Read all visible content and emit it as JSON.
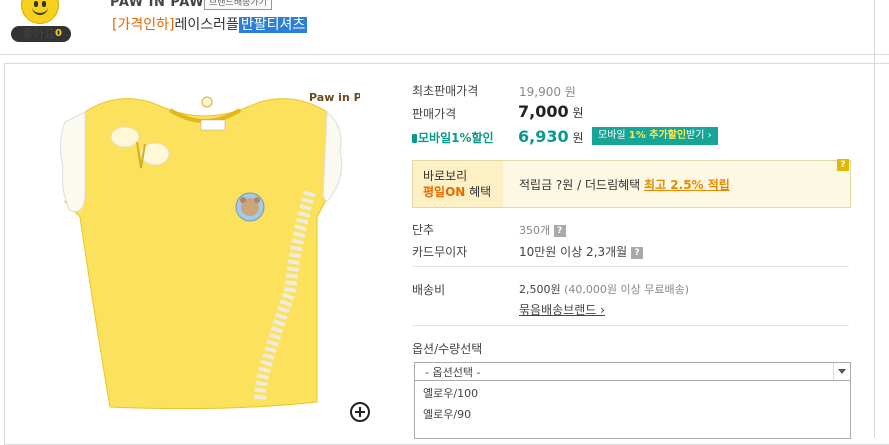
{
  "header": {
    "like_label": "좋아요",
    "like_count": "0",
    "brand_name": "PAW IN PAW",
    "brand_button": "브랜드배송가기",
    "title_prefix": "[가격인하]",
    "title_main": "레이스러플",
    "title_highlight": "반팔티셔츠"
  },
  "product_image": {
    "logo_text": "Paw in Paw",
    "zoom_icon": "zoom-in-icon"
  },
  "price": {
    "original_label": "최초판매가격",
    "original_value": "19,900 원",
    "sale_label": "판매가격",
    "sale_value": "7,000",
    "sale_unit": "원",
    "mobile_label": "모바일1%할인",
    "mobile_value": "6,930",
    "mobile_unit": "원",
    "mobile_button_prefix": "모바일 ",
    "mobile_button_strong": "1% 추가할인",
    "mobile_button_suffix": "받기 ›"
  },
  "benefit": {
    "left_line1": "바로보리",
    "left_line2_strong": "평일ON",
    "left_line2": " 혜택",
    "text": "적립금 ?원 / 더드림혜택 ",
    "link": "최고 2.5% 적립",
    "help": "?"
  },
  "details": {
    "danchu_label": "단추",
    "danchu_value": "350개",
    "card_label": "카드무이자",
    "card_value": "10만원 이상 2,3개월",
    "ship_label": "배송비",
    "ship_value": "2,500원",
    "ship_note": "(40,000원 이상 무료배송)",
    "ship_brand": "묶음배송브랜드 ›"
  },
  "options": {
    "label": "옵션/수량선택",
    "select_placeholder": "- 옵션선택 -",
    "items": [
      "옐로우/100",
      "옐로우/90"
    ]
  },
  "colors": {
    "accent_orange": "#e56a00",
    "mobile_teal": "#0a9a8a",
    "highlight_blue": "#2b7fd6"
  }
}
